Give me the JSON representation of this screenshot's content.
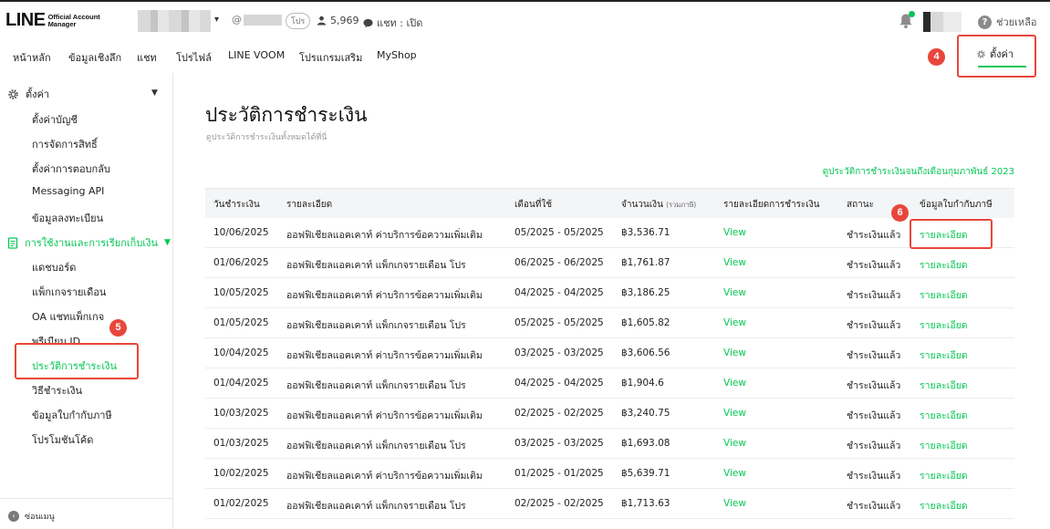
{
  "header": {
    "logo_main": "LINE",
    "logo_sub_1": "Official Account",
    "logo_sub_2": "Manager",
    "account_at": "@",
    "plan_badge": "โปร",
    "friend_count": "5,969",
    "chat_status": "แชท : เปิด",
    "help_label": "ช่วยเหลือ",
    "accent_color": "#06c755"
  },
  "nav": {
    "items": [
      "หน้าหลัก",
      "ข้อมูลเชิงลึก",
      "แชท",
      "โปรไฟล์",
      "LINE VOOM",
      "โปรแกรมเสริม",
      "MyShop"
    ],
    "settings_label": "ตั้งค่า"
  },
  "annotations": {
    "step4": "4",
    "step5": "5",
    "step6": "6",
    "highlight_color": "#e8463b"
  },
  "sidebar": {
    "settings_header": "ตั้งค่า",
    "settings_items": [
      "ตั้งค่าบัญชี",
      "การจัดการสิทธิ์",
      "ตั้งค่าการตอบกลับ",
      "Messaging API",
      "ข้อมูลลงทะเบียน"
    ],
    "billing_header": "การใช้งานและการเรียกเก็บเงิน",
    "billing_items": [
      "แดชบอร์ด",
      "แพ็กเกจรายเดือน",
      "OA แชทแพ็กเกจ",
      "พรีเมียม ID",
      "ประวัติการชำระเงิน",
      "วิธีชำระเงิน",
      "ข้อมูลใบกำกับภาษี",
      "โปรโมชันโค้ด"
    ],
    "collapse_label": "ซ่อนเมนู"
  },
  "main": {
    "title": "ประวัติการชำระเงิน",
    "subtitle": "ดูประวัติการชำระเงินทั้งหมดได้ที่นี่",
    "history_link": "ดูประวัติการชำระเงินจนถึงเดือนกุมภาพันธ์ 2023"
  },
  "table": {
    "headers": {
      "date": "วันชำระเงิน",
      "description": "รายละเอียด",
      "month": "เดือนที่ใช้",
      "amount": "จำนวนเงิน",
      "amount_note": "(รวมภาษี)",
      "payment_detail": "รายละเอียดการชำระเงิน",
      "status": "สถานะ",
      "tax_invoice": "ข้อมูลใบกำกับภาษี"
    },
    "rows": [
      {
        "date": "10/06/2025",
        "desc": "ออฟฟิเชียลแอคเคาท์ ค่าบริการข้อความเพิ่มเติม",
        "month": "05/2025 - 05/2025",
        "amount": "฿3,536.71",
        "view": "View",
        "status": "ชำระเงินแล้ว",
        "detail": "รายละเอียด"
      },
      {
        "date": "01/06/2025",
        "desc": "ออฟฟิเชียลแอคเคาท์ แพ็กเกจรายเดือน โปร",
        "month": "06/2025 - 06/2025",
        "amount": "฿1,761.87",
        "view": "View",
        "status": "ชำระเงินแล้ว",
        "detail": "รายละเอียด"
      },
      {
        "date": "10/05/2025",
        "desc": "ออฟฟิเชียลแอคเคาท์ ค่าบริการข้อความเพิ่มเติม",
        "month": "04/2025 - 04/2025",
        "amount": "฿3,186.25",
        "view": "View",
        "status": "ชำระเงินแล้ว",
        "detail": "รายละเอียด"
      },
      {
        "date": "01/05/2025",
        "desc": "ออฟฟิเชียลแอคเคาท์ แพ็กเกจรายเดือน โปร",
        "month": "05/2025 - 05/2025",
        "amount": "฿1,605.82",
        "view": "View",
        "status": "ชำระเงินแล้ว",
        "detail": "รายละเอียด"
      },
      {
        "date": "10/04/2025",
        "desc": "ออฟฟิเชียลแอคเคาท์ ค่าบริการข้อความเพิ่มเติม",
        "month": "03/2025 - 03/2025",
        "amount": "฿3,606.56",
        "view": "View",
        "status": "ชำระเงินแล้ว",
        "detail": "รายละเอียด"
      },
      {
        "date": "01/04/2025",
        "desc": "ออฟฟิเชียลแอคเคาท์ แพ็กเกจรายเดือน โปร",
        "month": "04/2025 - 04/2025",
        "amount": "฿1,904.6",
        "view": "View",
        "status": "ชำระเงินแล้ว",
        "detail": "รายละเอียด"
      },
      {
        "date": "10/03/2025",
        "desc": "ออฟฟิเชียลแอคเคาท์ ค่าบริการข้อความเพิ่มเติม",
        "month": "02/2025 - 02/2025",
        "amount": "฿3,240.75",
        "view": "View",
        "status": "ชำระเงินแล้ว",
        "detail": "รายละเอียด"
      },
      {
        "date": "01/03/2025",
        "desc": "ออฟฟิเชียลแอคเคาท์ แพ็กเกจรายเดือน โปร",
        "month": "03/2025 - 03/2025",
        "amount": "฿1,693.08",
        "view": "View",
        "status": "ชำระเงินแล้ว",
        "detail": "รายละเอียด"
      },
      {
        "date": "10/02/2025",
        "desc": "ออฟฟิเชียลแอคเคาท์ ค่าบริการข้อความเพิ่มเติม",
        "month": "01/2025 - 01/2025",
        "amount": "฿5,639.71",
        "view": "View",
        "status": "ชำระเงินแล้ว",
        "detail": "รายละเอียด"
      },
      {
        "date": "01/02/2025",
        "desc": "ออฟฟิเชียลแอคเคาท์ แพ็กเกจรายเดือน โปร",
        "month": "02/2025 - 02/2025",
        "amount": "฿1,713.63",
        "view": "View",
        "status": "ชำระเงินแล้ว",
        "detail": "รายละเอียด"
      }
    ]
  }
}
